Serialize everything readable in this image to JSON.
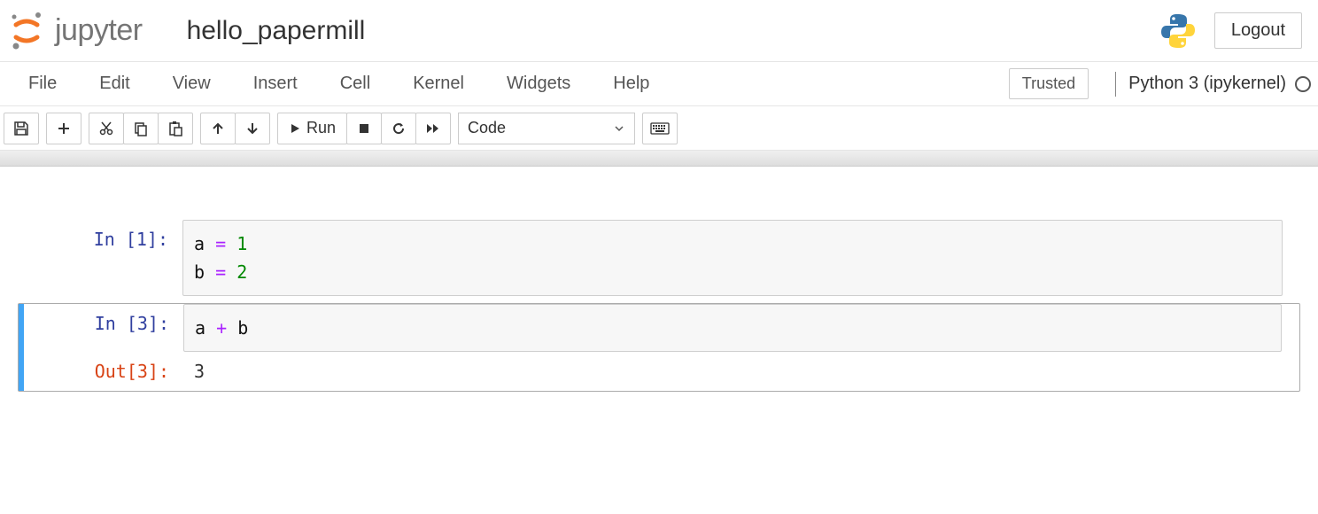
{
  "header": {
    "logo_text": "jupyter",
    "notebook_name": "hello_papermill",
    "logout_label": "Logout"
  },
  "menubar": {
    "items": [
      "File",
      "Edit",
      "View",
      "Insert",
      "Cell",
      "Kernel",
      "Widgets",
      "Help"
    ],
    "trusted_label": "Trusted",
    "kernel_name": "Python 3 (ipykernel)"
  },
  "toolbar": {
    "run_label": "Run",
    "celltype_selected": "Code"
  },
  "cells": [
    {
      "in_prompt": "In [1]:",
      "code_tokens": [
        [
          {
            "t": "a",
            "c": "var"
          },
          {
            "t": " "
          },
          {
            "t": "=",
            "c": "op"
          },
          {
            "t": " "
          },
          {
            "t": "1",
            "c": "num"
          }
        ],
        [
          {
            "t": "b",
            "c": "var"
          },
          {
            "t": " "
          },
          {
            "t": "=",
            "c": "op"
          },
          {
            "t": " "
          },
          {
            "t": "2",
            "c": "num"
          }
        ]
      ],
      "selected": false
    },
    {
      "in_prompt": "In [3]:",
      "code_tokens": [
        [
          {
            "t": "a",
            "c": "var"
          },
          {
            "t": " "
          },
          {
            "t": "+",
            "c": "op"
          },
          {
            "t": " "
          },
          {
            "t": "b",
            "c": "var"
          }
        ]
      ],
      "out_prompt": "Out[3]:",
      "output": "3",
      "selected": true
    }
  ]
}
